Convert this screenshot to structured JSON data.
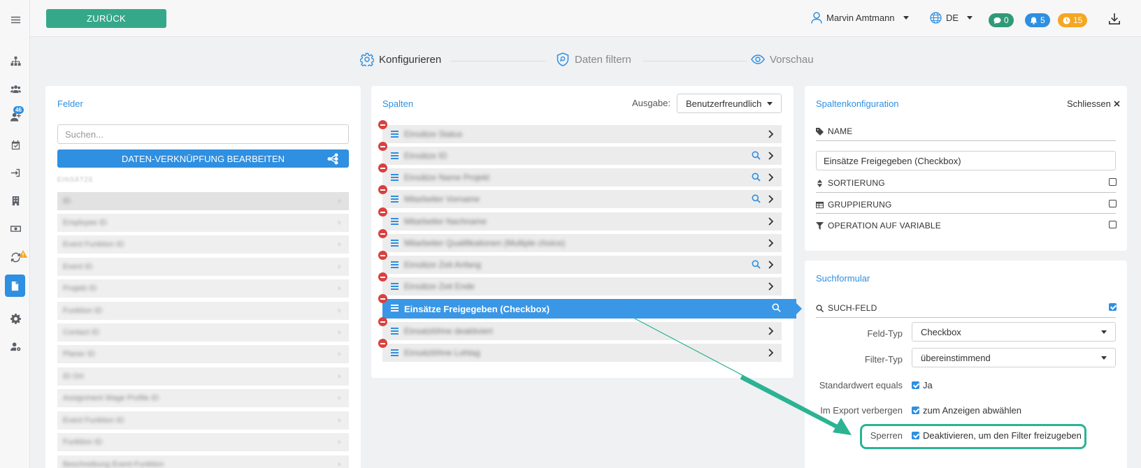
{
  "topbar": {
    "back_label": "ZURÜCK",
    "user_name": "Marvin Amtmann",
    "language": "DE",
    "badges": [
      {
        "icon": "chat-icon",
        "count": "0",
        "color": "#2f9a77"
      },
      {
        "icon": "bell-icon",
        "count": "5",
        "color": "#2f8fe0"
      },
      {
        "icon": "clock-icon",
        "count": "15",
        "color": "#f5a623"
      }
    ]
  },
  "sidebar": {
    "items": [
      {
        "icon": "hamburger-icon"
      },
      {
        "icon": "org-chart-icon"
      },
      {
        "icon": "users-icon"
      },
      {
        "icon": "add-user-icon",
        "badge": "46"
      },
      {
        "icon": "calendar-check-icon"
      },
      {
        "icon": "sign-in-icon"
      },
      {
        "icon": "building-icon"
      },
      {
        "icon": "money-icon"
      },
      {
        "icon": "sync-icon",
        "warning": true
      },
      {
        "icon": "document-icon",
        "active": true
      },
      {
        "icon": "gear-icon"
      },
      {
        "icon": "user-cog-icon"
      }
    ]
  },
  "steps": [
    {
      "label": "Konfigurieren",
      "icon": "gear-icon",
      "active": true
    },
    {
      "label": "Daten filtern",
      "icon": "shield-search-icon",
      "active": false
    },
    {
      "label": "Vorschau",
      "icon": "eye-icon",
      "active": false
    }
  ],
  "felder": {
    "title": "Felder",
    "search_placeholder": "Suchen...",
    "button_label": "DATEN-VERKNÜPFUNG BEARBEITEN",
    "group_label": "EINSÄTZE",
    "rows": [
      "ID",
      "Employee ID",
      "Event Funktion ID",
      "Event ID",
      "Projekt ID",
      "Funktion ID",
      "Contact ID",
      "Planer ID",
      "ID Ort",
      "Assignment Wage Profile ID",
      "Event Funktion ID",
      "Funktion ID",
      "Beschreibung Event-Funktion"
    ]
  },
  "spalten": {
    "title": "Spalten",
    "ausgabe_label": "Ausgabe:",
    "ausgabe_value": "Benutzerfreundlich",
    "rows": [
      {
        "label": "Einsätze Status",
        "search": false
      },
      {
        "label": "Einsätze ID",
        "search": true
      },
      {
        "label": "Einsätze Name Projekt",
        "search": true
      },
      {
        "label": "Mitarbeiter Vorname",
        "search": true
      },
      {
        "label": "Mitarbeiter Nachname",
        "search": false
      },
      {
        "label": "Mitarbeiter Qualifikationen (Multiple choice)",
        "search": false
      },
      {
        "label": "Einsätze Zeit Anfang",
        "search": true
      },
      {
        "label": "Einsätze Zeit Ende",
        "search": false
      },
      {
        "label": "Einsätze Freigegeben (Checkbox)",
        "search": true,
        "selected": true
      },
      {
        "label": "Einsatzlöhne deaktiviert",
        "search": false
      },
      {
        "label": "Einsatzlöhne Lohtag",
        "search": false
      }
    ]
  },
  "config": {
    "title": "Spaltenkonfiguration",
    "close_label": "Schliessen",
    "name_label": "NAME",
    "name_value": "Einsätze Freigegeben (Checkbox)",
    "sort_label": "SORTIERUNG",
    "group_label": "GRUPPIERUNG",
    "operation_label": "OPERATION AUF VARIABLE",
    "sort_checked": false,
    "group_checked": false,
    "operation_checked": false
  },
  "suchformular": {
    "title": "Suchformular",
    "field_label": "SUCH-FELD",
    "field_checked": true,
    "feld_typ_label": "Feld-Typ",
    "feld_typ_value": "Checkbox",
    "filter_typ_label": "Filter-Typ",
    "filter_typ_value": "übereinstimmend",
    "default_label": "Standardwert equals",
    "default_value": "Ja",
    "default_checked": true,
    "export_label": "Im Export verbergen",
    "export_value": "zum Anzeigen abwählen",
    "export_checked": true,
    "lock_label": "Sperren",
    "lock_value": "Deaktivieren, um den Filter freizugeben",
    "lock_checked": true
  },
  "colors": {
    "accent": "#2f8fe0",
    "back_button": "#36a88a",
    "highlight": "#2bb394",
    "remove": "#d9403f"
  }
}
